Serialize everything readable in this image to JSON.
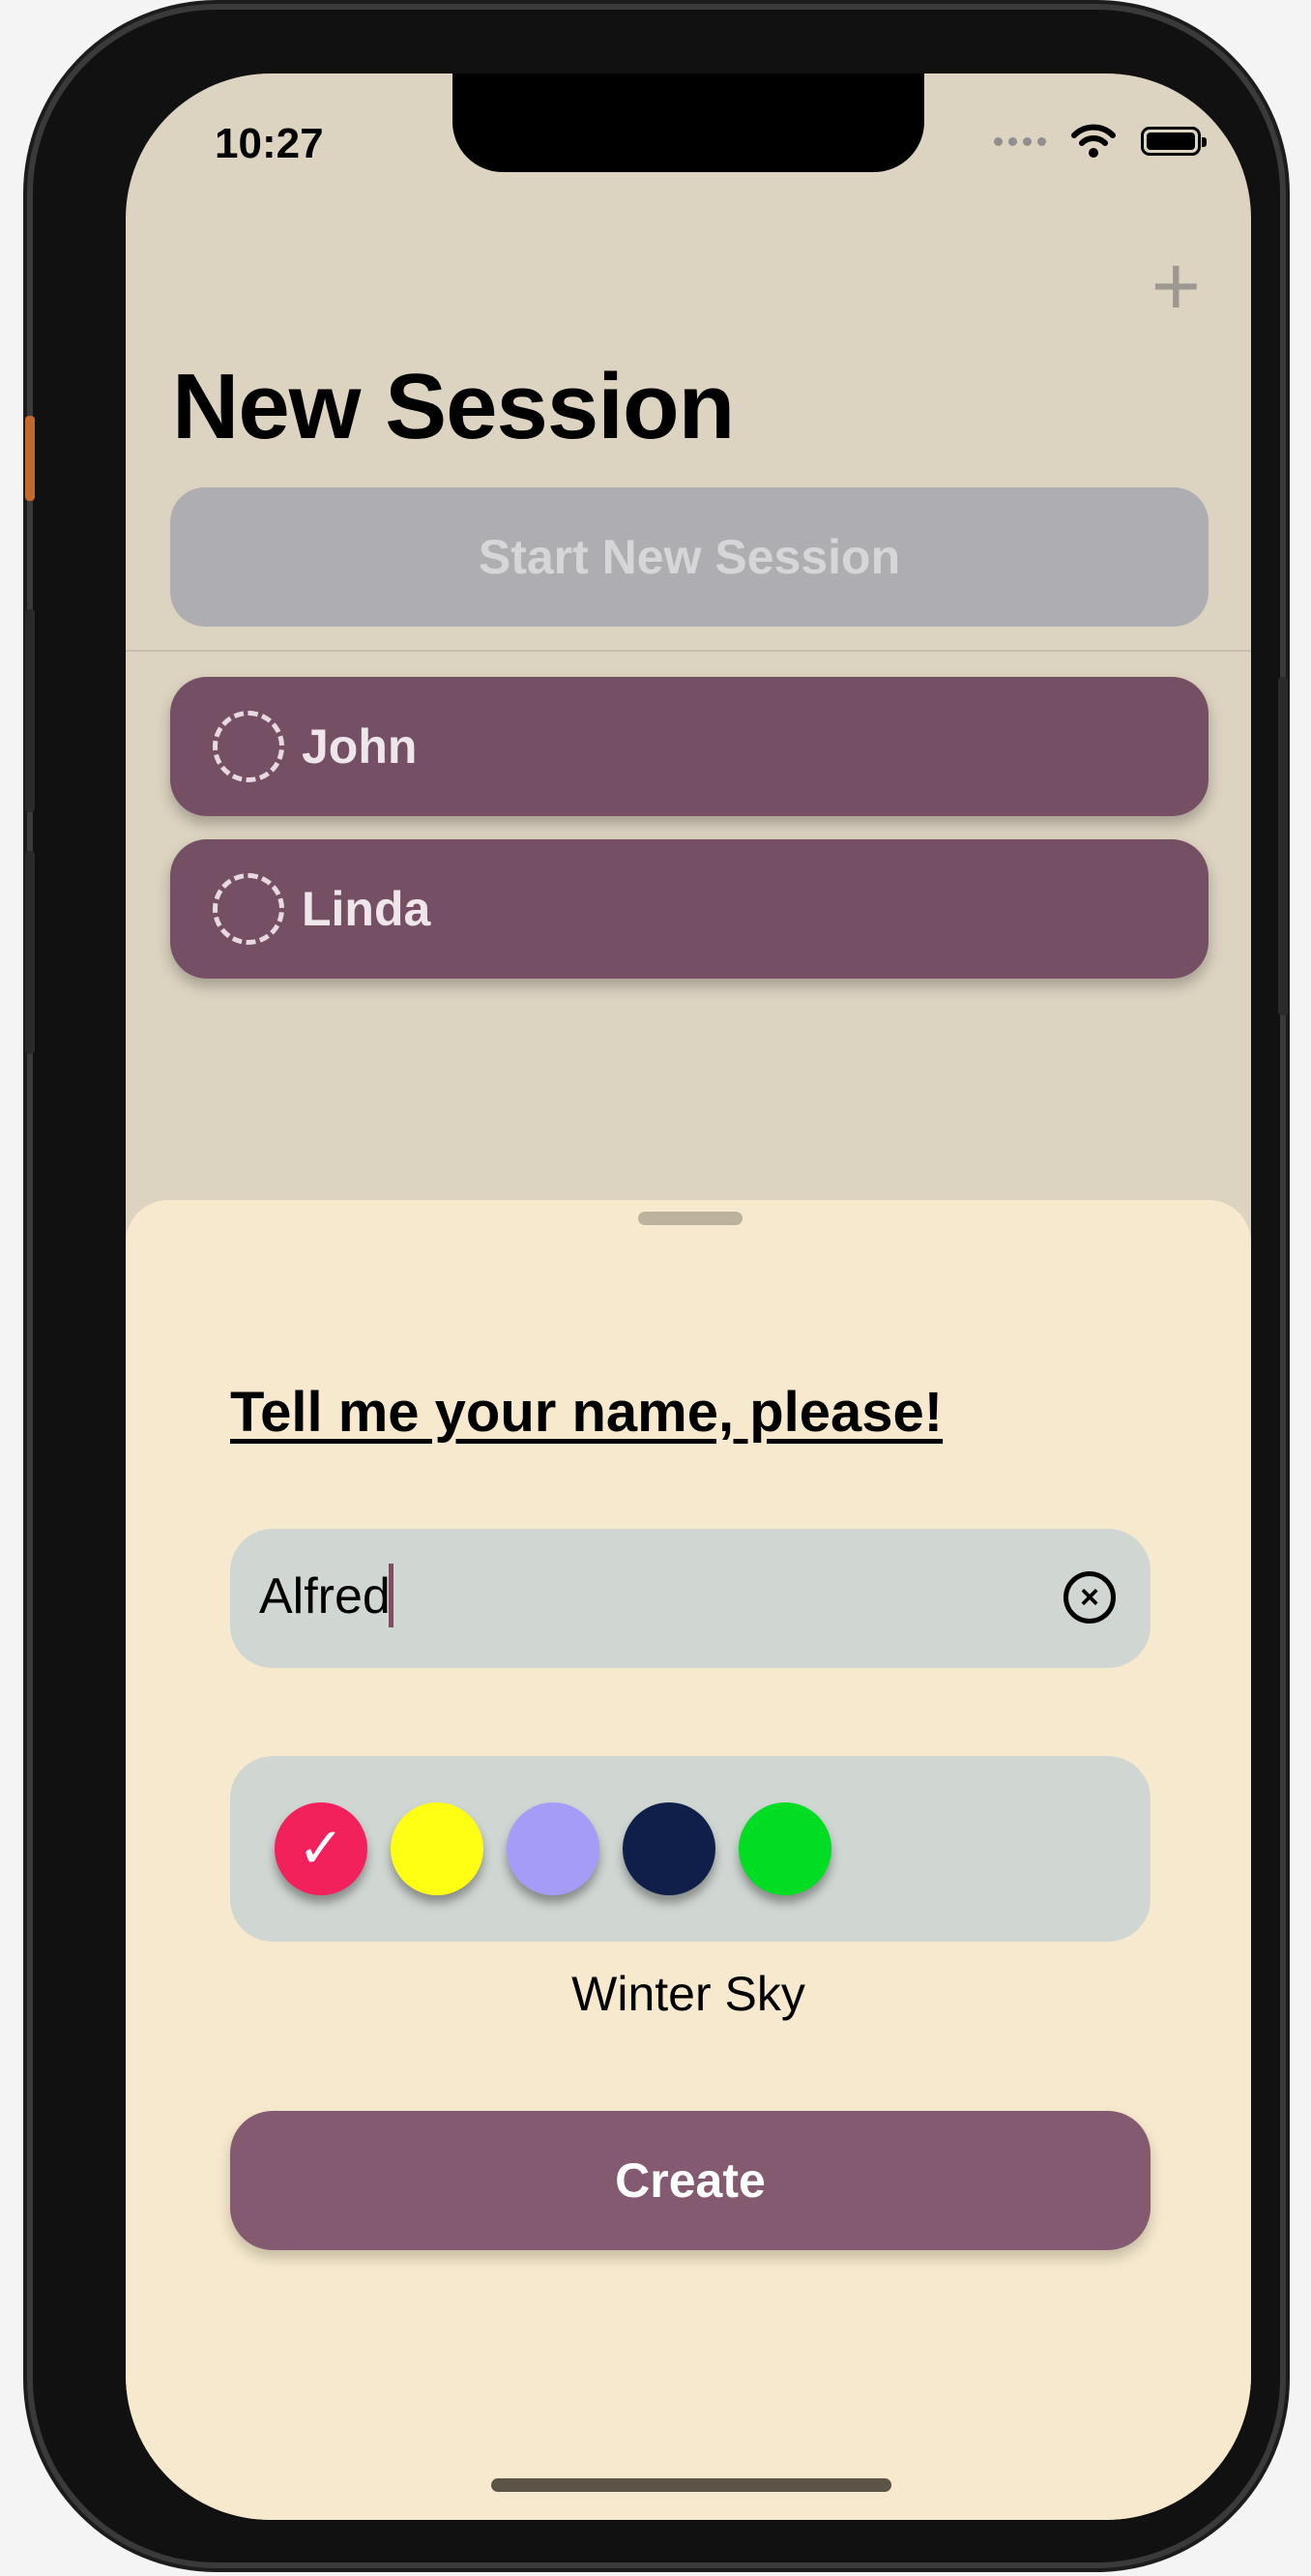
{
  "status": {
    "time": "10:27"
  },
  "nav": {
    "add_label": "+",
    "title": "New Session"
  },
  "start_button": {
    "label": "Start New Session"
  },
  "people": [
    {
      "name": "John"
    },
    {
      "name": "Linda"
    }
  ],
  "sheet": {
    "prompt": "Tell me your name, please!",
    "name_input": {
      "value": "Alfred",
      "clear_icon": "xmark-circle-icon"
    },
    "colors": [
      {
        "hex": "#f2215c",
        "selected": true
      },
      {
        "hex": "#ffff14"
      },
      {
        "hex": "#a59cf7"
      },
      {
        "hex": "#0f1f4a"
      },
      {
        "hex": "#00dd22"
      }
    ],
    "selected_color_name": "Winter Sky",
    "create_label": "Create"
  },
  "colors": {
    "background": "#dcd3c0",
    "sheet": "#f6e9cd",
    "person_card": "#754f63",
    "create_button": "#845a70",
    "start_button_disabled": "#aeadb2"
  }
}
